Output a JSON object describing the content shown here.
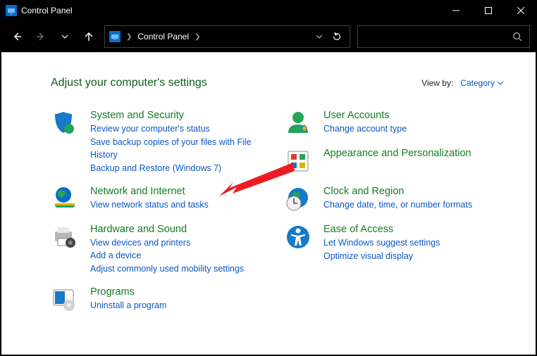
{
  "title": "Control Panel",
  "breadcrumb": "Control Panel",
  "heading": "Adjust your computer's settings",
  "viewby_label": "View by:",
  "viewby_value": "Category",
  "left": [
    {
      "title": "System and Security",
      "links": [
        "Review your computer's status",
        "Save backup copies of your files with File History",
        "Backup and Restore (Windows 7)"
      ]
    },
    {
      "title": "Network and Internet",
      "links": [
        "View network status and tasks"
      ]
    },
    {
      "title": "Hardware and Sound",
      "links": [
        "View devices and printers",
        "Add a device",
        "Adjust commonly used mobility settings"
      ]
    },
    {
      "title": "Programs",
      "links": [
        "Uninstall a program"
      ]
    }
  ],
  "right": [
    {
      "title": "User Accounts",
      "links": [
        "Change account type"
      ]
    },
    {
      "title": "Appearance and Personalization",
      "links": []
    },
    {
      "title": "Clock and Region",
      "links": [
        "Change date, time, or number formats"
      ]
    },
    {
      "title": "Ease of Access",
      "links": [
        "Let Windows suggest settings",
        "Optimize visual display"
      ]
    }
  ]
}
